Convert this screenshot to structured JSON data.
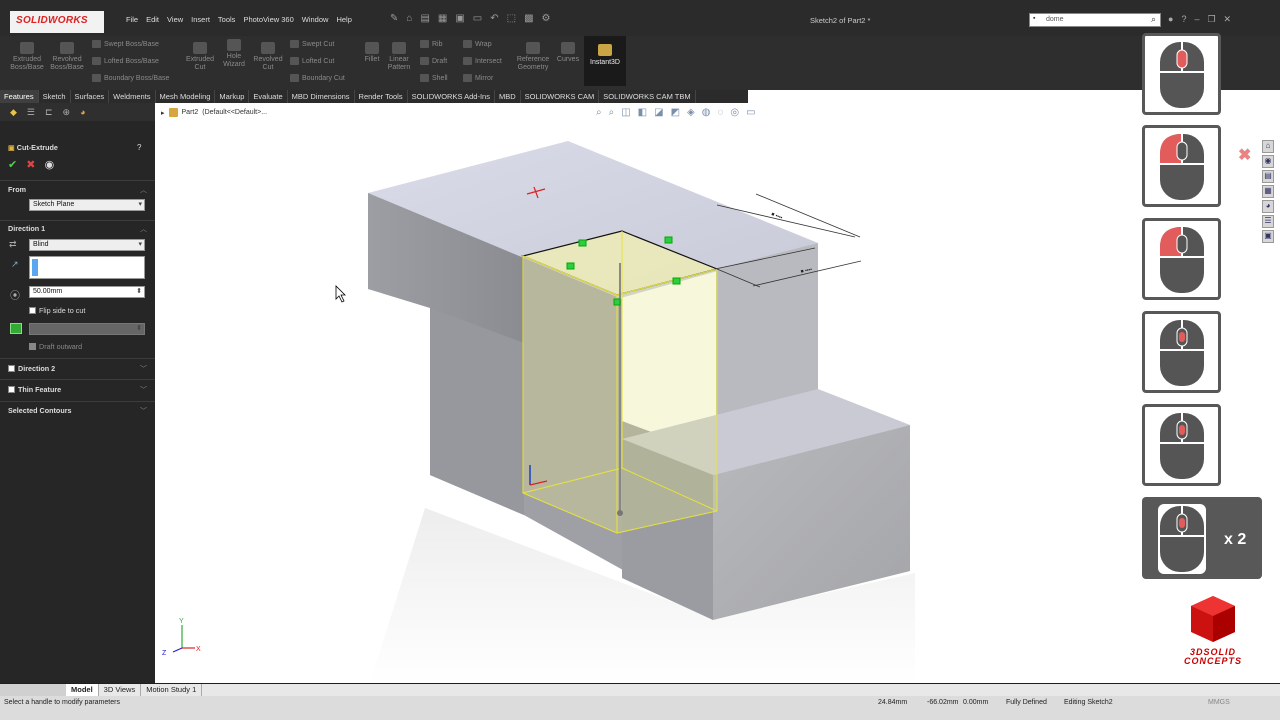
{
  "app": {
    "logo": "SOLIDWORKS",
    "document_title": "Sketch2 of Part2 *"
  },
  "menus": [
    "File",
    "Edit",
    "View",
    "Insert",
    "Tools",
    "PhotoView 360",
    "Window",
    "Help"
  ],
  "search": {
    "value": "dome"
  },
  "toolbar": {
    "extruded_boss": "Extruded Boss/Base",
    "revolved_boss": "Revolved Boss/Base",
    "swept_boss": "Swept Boss/Base",
    "lofted_boss": "Lofted Boss/Base",
    "boundary_boss": "Boundary Boss/Base",
    "extruded_cut": "Extruded Cut",
    "hole_wizard": "Hole Wizard",
    "revolved_cut": "Revolved Cut",
    "swept_cut": "Swept Cut",
    "lofted_cut": "Lofted Cut",
    "boundary_cut": "Boundary Cut",
    "fillet": "Fillet",
    "linear_pattern": "Linear Pattern",
    "rib": "Rib",
    "draft": "Draft",
    "shell": "Shell",
    "wrap": "Wrap",
    "intersect": "Intersect",
    "mirror": "Mirror",
    "reference_geometry": "Reference Geometry",
    "curves": "Curves",
    "instant3d": "Instant3D"
  },
  "tabs": [
    "Features",
    "Sketch",
    "Surfaces",
    "Weldments",
    "Mesh Modeling",
    "Markup",
    "Evaluate",
    "MBD Dimensions",
    "Render Tools",
    "SOLIDWORKS Add-Ins",
    "MBD",
    "SOLIDWORKS CAM",
    "SOLIDWORKS CAM TBM"
  ],
  "property_manager": {
    "title": "Cut-Extrude",
    "from_label": "From",
    "from_value": "Sketch Plane",
    "direction1_label": "Direction 1",
    "end_condition": "Blind",
    "depth": "50.00mm",
    "flip_side": "Flip side to cut",
    "draft_outward": "Draft outward",
    "direction2_label": "Direction 2",
    "thin_feature_label": "Thin Feature",
    "selected_contours_label": "Selected Contours"
  },
  "tree": {
    "part": "Part2",
    "config": "(Default<<Default>..."
  },
  "model_tabs": [
    "Model",
    "3D Views",
    "Motion Study 1"
  ],
  "status": {
    "message": "Select a handle to modify parameters",
    "x": "24.84mm",
    "y": "-66.02mm",
    "z": "0.00mm",
    "state": "Fully Defined",
    "editing": "Editing Sketch2",
    "units": "MMGS"
  },
  "mouse_overlay": {
    "multiplier": "x 2"
  },
  "brand": {
    "line1": "3DSOLID",
    "line2": "CONCEPTS"
  },
  "colors": {
    "accent_red": "#e25c5c",
    "yellow_sketch": "#e7e33a",
    "panel_dark": "#262626"
  }
}
